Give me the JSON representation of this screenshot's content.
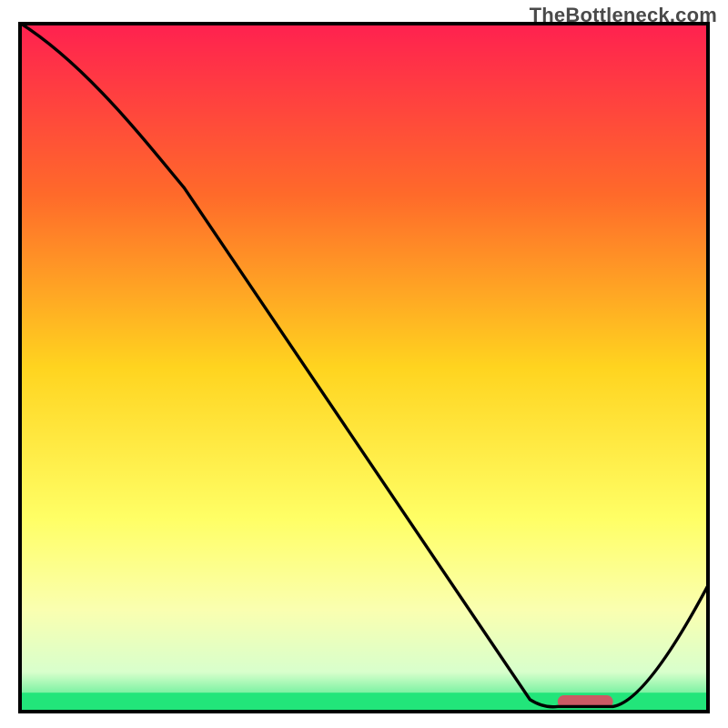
{
  "watermark": "TheBottleneck.com",
  "chart_data": {
    "type": "line",
    "title": "",
    "xlabel": "",
    "ylabel": "",
    "xlim": [
      0,
      100
    ],
    "ylim": [
      0,
      100
    ],
    "gradient_stops": [
      {
        "offset": 0,
        "color": "#ff2050"
      },
      {
        "offset": 25,
        "color": "#ff6a2a"
      },
      {
        "offset": 50,
        "color": "#ffd41f"
      },
      {
        "offset": 72,
        "color": "#ffff66"
      },
      {
        "offset": 85,
        "color": "#faffb0"
      },
      {
        "offset": 94,
        "color": "#d8ffcc"
      },
      {
        "offset": 100,
        "color": "#22e57a"
      }
    ],
    "series": [
      {
        "name": "curve",
        "points": [
          {
            "x": 0,
            "y": 100
          },
          {
            "x": 24,
            "y": 76
          },
          {
            "x": 74,
            "y": 2
          },
          {
            "x": 78,
            "y": 1
          },
          {
            "x": 86,
            "y": 1
          },
          {
            "x": 100,
            "y": 19
          }
        ]
      }
    ],
    "marker": {
      "name": "highlight-bar",
      "x_start": 78,
      "x_end": 86,
      "color": "#cc5a64"
    },
    "frame_color": "#000000",
    "green_band": {
      "y_start": 0,
      "y_end": 3
    }
  }
}
